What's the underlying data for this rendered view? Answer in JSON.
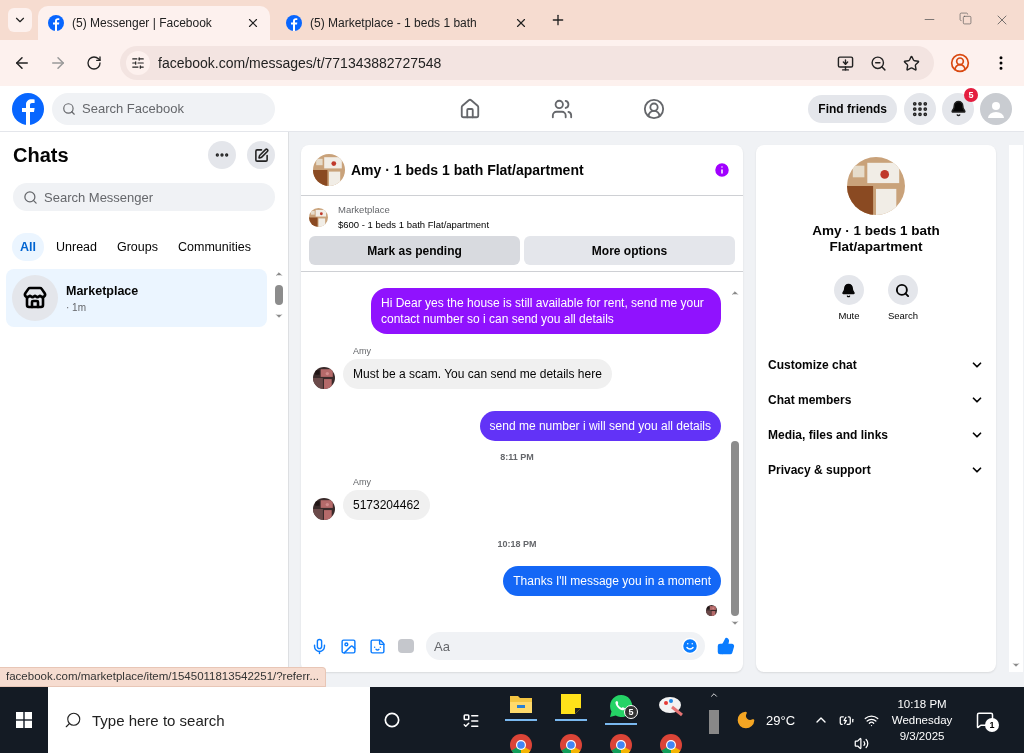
{
  "browser": {
    "tabs": [
      {
        "title": "(5) Messenger | Facebook",
        "selected": true
      },
      {
        "title": "(5) Marketplace - 1 beds 1 bath",
        "selected": false
      }
    ],
    "url": "facebook.com/messages/t/771343882727548"
  },
  "facebook_header": {
    "search_placeholder": "Search Facebook",
    "find_friends": "Find friends",
    "notification_count": "5"
  },
  "chats": {
    "title": "Chats",
    "search_placeholder": "Search Messenger",
    "filters": [
      {
        "label": "All",
        "selected": true
      },
      {
        "label": "Unread",
        "selected": false
      },
      {
        "label": "Groups",
        "selected": false
      },
      {
        "label": "Communities",
        "selected": false
      }
    ],
    "conversations": [
      {
        "name": "Marketplace",
        "time": "· 1m",
        "selected": true
      }
    ]
  },
  "conversation": {
    "title": "Amy · 1 beds 1 bath Flat/apartment",
    "listing": {
      "source": "Marketplace",
      "summary": "$600 - 1 beds 1 bath Flat/apartment"
    },
    "actions": [
      "Mark as pending",
      "More options"
    ],
    "messages": [
      {
        "kind": "sent",
        "text": "Hi Dear yes the house is still available for rent, send me your contact number so i can send you all details",
        "color": "#9012fe"
      },
      {
        "kind": "received",
        "sender": "Amy",
        "text": "Must be a scam. You can send me details here"
      },
      {
        "kind": "sent",
        "text": "send me number i will send you all details",
        "color": "#6233f7"
      },
      {
        "kind": "timestamp",
        "text": "8:11 PM"
      },
      {
        "kind": "received",
        "sender": "Amy",
        "text": "5173204462"
      },
      {
        "kind": "timestamp",
        "text": "10:18 PM"
      },
      {
        "kind": "sent",
        "text": "Thanks I'll message you in a moment",
        "color": "#1467f6"
      }
    ],
    "composer_placeholder": "Aa"
  },
  "details": {
    "name": "Amy · 1 beds 1 bath Flat/apartment",
    "actions": [
      {
        "kind": "mute",
        "label": "Mute"
      },
      {
        "kind": "search",
        "label": "Search"
      }
    ],
    "sections": [
      {
        "label": "Customize chat",
        "expanded": false
      },
      {
        "label": "Chat members",
        "expanded": false
      },
      {
        "label": "Media, files and links",
        "expanded": false
      },
      {
        "label": "Privacy & support",
        "expanded": false
      }
    ]
  },
  "status_url": "facebook.com/marketplace/item/1545011813542251/?referr...",
  "taskbar": {
    "search_placeholder": "Type here to search",
    "apps": [
      {
        "kind": "files",
        "running": true
      },
      {
        "kind": "notes",
        "running": true
      },
      {
        "kind": "whatsapp",
        "running": true,
        "badge": "5"
      },
      {
        "kind": "paint",
        "running": false
      },
      {
        "kind": "browser"
      },
      {
        "kind": "browser"
      },
      {
        "kind": "browser"
      },
      {
        "kind": "browser"
      }
    ],
    "weather": "29°C",
    "time": "10:18 PM",
    "day": "Wednesday",
    "date": "9/3/2025",
    "notification_count": "1"
  }
}
